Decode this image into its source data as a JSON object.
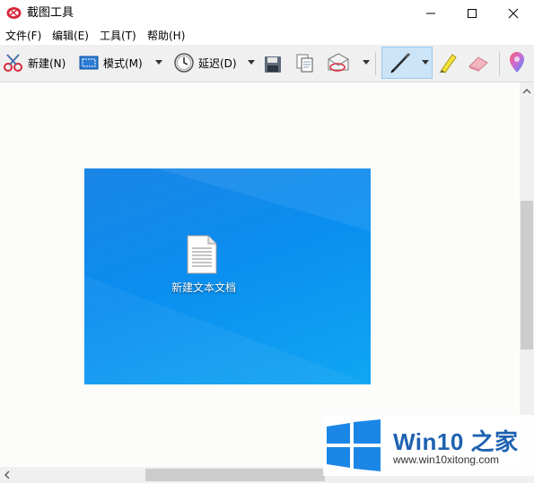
{
  "window": {
    "title": "截图工具"
  },
  "menu": [
    "文件(F)",
    "编辑(E)",
    "工具(T)",
    "帮助(H)"
  ],
  "toolbar": {
    "new_label": "新建(N)",
    "mode_label": "模式(M)",
    "delay_label": "延迟(D)"
  },
  "capture": {
    "desktop_icon_label": "新建文本文档"
  },
  "watermark": {
    "brand": "Win10 之家",
    "url": "www.win10xitong.com"
  },
  "colors": {
    "accent": "#0078d7",
    "desktop_blue": "#0a8ef0",
    "pen_active_bg": "#cce4f7"
  },
  "icons": [
    "scissors-icon",
    "mode-rect-icon",
    "clock-icon",
    "save-icon",
    "copy-icon",
    "send-email-icon",
    "pen-icon",
    "highlighter-icon",
    "eraser-icon",
    "paint3d-icon",
    "minimize-icon",
    "maximize-icon",
    "close-icon"
  ]
}
